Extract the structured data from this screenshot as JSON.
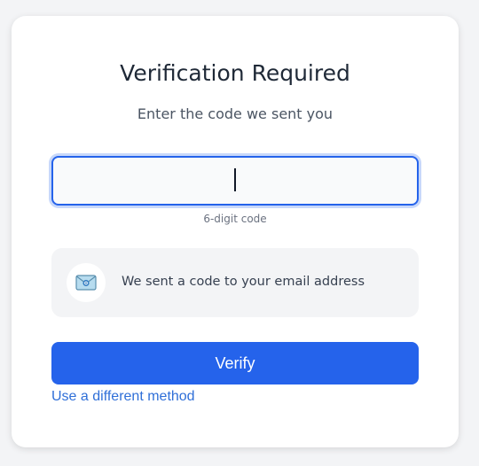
{
  "card": {
    "title": "Verification Required",
    "subtitle": "Enter the code we sent you"
  },
  "code_input": {
    "value": "",
    "placeholder": "",
    "hint": "6-digit code"
  },
  "info": {
    "icon": "envelope-icon",
    "text": "We sent a code to your email address"
  },
  "actions": {
    "verify_label": "Verify",
    "alt_method_label": "Use a different method"
  },
  "colors": {
    "accent": "#2563eb",
    "link": "#2f6fd8",
    "background": "#f3f4f6",
    "card": "#ffffff"
  }
}
